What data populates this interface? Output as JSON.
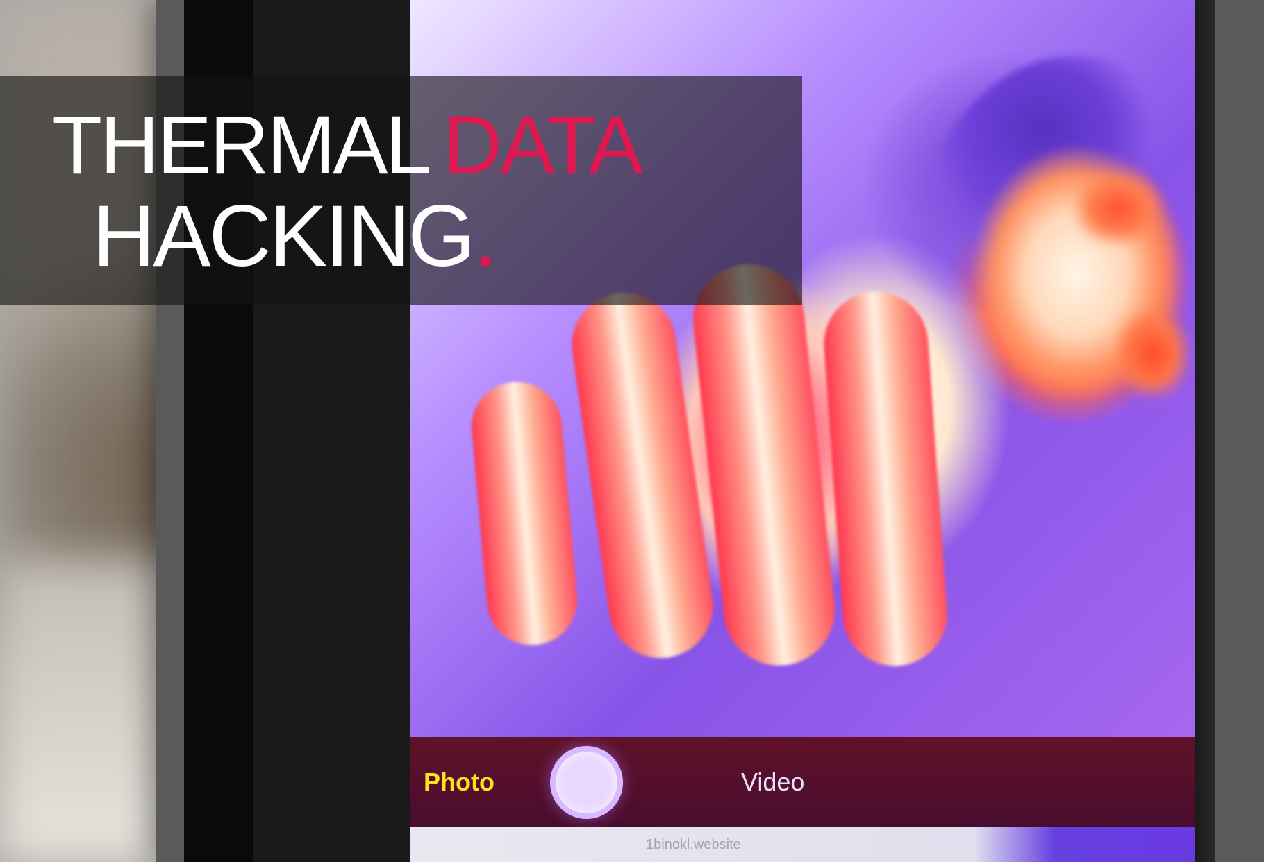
{
  "overlay": {
    "line1_word1": "THERMAL",
    "line1_word2": "DATA",
    "line2_word1": "HACKING",
    "line2_dot": "."
  },
  "camera": {
    "mode_photo_label": "Photo",
    "mode_video_label": "Video"
  },
  "bottom_bar": {
    "url_text": "1binokl.website"
  },
  "colors": {
    "accent": "#e01850",
    "mode_active": "#ffe020",
    "text_light": "#ffffff",
    "thermal_hot": "#ff4a5e",
    "thermal_cold": "#8453e0"
  }
}
